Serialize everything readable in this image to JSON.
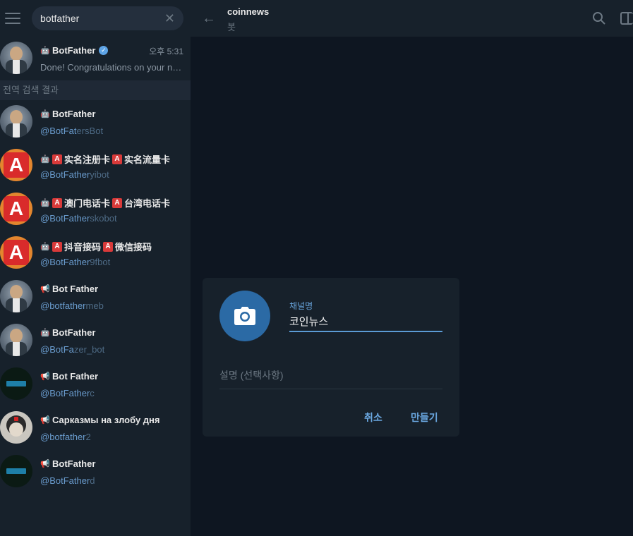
{
  "search": {
    "query": "botfather"
  },
  "pinned_chat": {
    "title": "BotFather",
    "verified": true,
    "time": "오후 5:31",
    "message": "Done! Congratulations on your new bot"
  },
  "section_label": "전역 검색 결과",
  "results": [
    {
      "icon": "bot",
      "title": "BotFather",
      "handle_hl": "@BotFather",
      "handle_rest": "sBot",
      "handle_hl_prefix": "@BotFat",
      "handle_rest_full": "ersBot",
      "avatar": "bf"
    },
    {
      "icon": "bot",
      "title": "实名注册卡",
      "title2": "实名流量卡",
      "handle_hl": "@BotFather",
      "handle_rest": "yibot",
      "avatar": "a"
    },
    {
      "icon": "bot",
      "title": "澳门电话卡",
      "title2": "台湾电话卡",
      "handle_hl": "@BotFather",
      "handle_rest": "skobot",
      "avatar": "a"
    },
    {
      "icon": "bot",
      "title": "抖音接码",
      "title2": "微信接码",
      "handle_hl": "@BotFather",
      "handle_rest": "9fbot",
      "avatar": "a"
    },
    {
      "icon": "channel",
      "title": "Bot Father",
      "handle_hl": "@botfather",
      "handle_rest": "meb",
      "avatar": "bf"
    },
    {
      "icon": "bot",
      "title": "BotFather",
      "handle_hl": "@BotFa",
      "handle_rest": "zer_bot",
      "avatar": "bf"
    },
    {
      "icon": "channel",
      "title": "Bot Father",
      "handle_hl": "@BotFather",
      "handle_rest": "c",
      "avatar": "dark"
    },
    {
      "icon": "channel",
      "title": "Сарказмы на злобу дня",
      "handle_hl": "@botfather",
      "handle_rest": "2",
      "avatar": "meme"
    },
    {
      "icon": "channel",
      "title": "BotFather",
      "handle_hl": "@BotFather",
      "handle_rest": "d",
      "avatar": "dark"
    }
  ],
  "header": {
    "title": "coinnews",
    "subtitle": "봇"
  },
  "dialog": {
    "name_label": "채널명",
    "name_value": "코인뉴스",
    "description_placeholder": "설명 (선택사항)",
    "cancel_label": "취소",
    "create_label": "만들기"
  },
  "colors": {
    "accent": "#6aa7e0",
    "avatar_blue": "#2b6aa5",
    "background": "#0e1621",
    "panel": "#17212b"
  }
}
